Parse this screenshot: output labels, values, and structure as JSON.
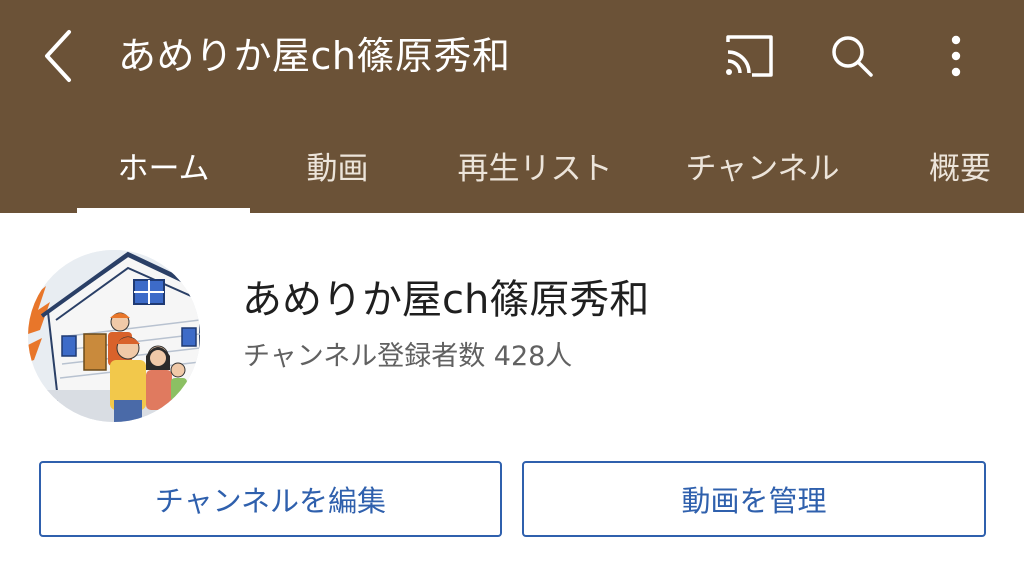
{
  "header": {
    "title": "あめりか屋ch篠原秀和",
    "back_icon": "chevron-left-icon",
    "actions": [
      {
        "name": "cast",
        "icon": "cast-icon"
      },
      {
        "name": "search",
        "icon": "search-icon"
      },
      {
        "name": "more",
        "icon": "more-vert-icon"
      }
    ],
    "color": "#6b5237"
  },
  "tabs": [
    {
      "label": "ホーム",
      "active": true
    },
    {
      "label": "動画",
      "active": false
    },
    {
      "label": "再生リスト",
      "active": false
    },
    {
      "label": "チャンネル",
      "active": false
    },
    {
      "label": "概要",
      "active": false
    }
  ],
  "channel": {
    "name": "あめりか屋ch篠原秀和",
    "subscribers": "チャンネル登録者数 428人",
    "avatar": "channel-avatar-illustration"
  },
  "buttons": {
    "edit_channel": "チャンネルを編集",
    "manage_videos": "動画を管理"
  },
  "accent_color": "#2f60ad"
}
